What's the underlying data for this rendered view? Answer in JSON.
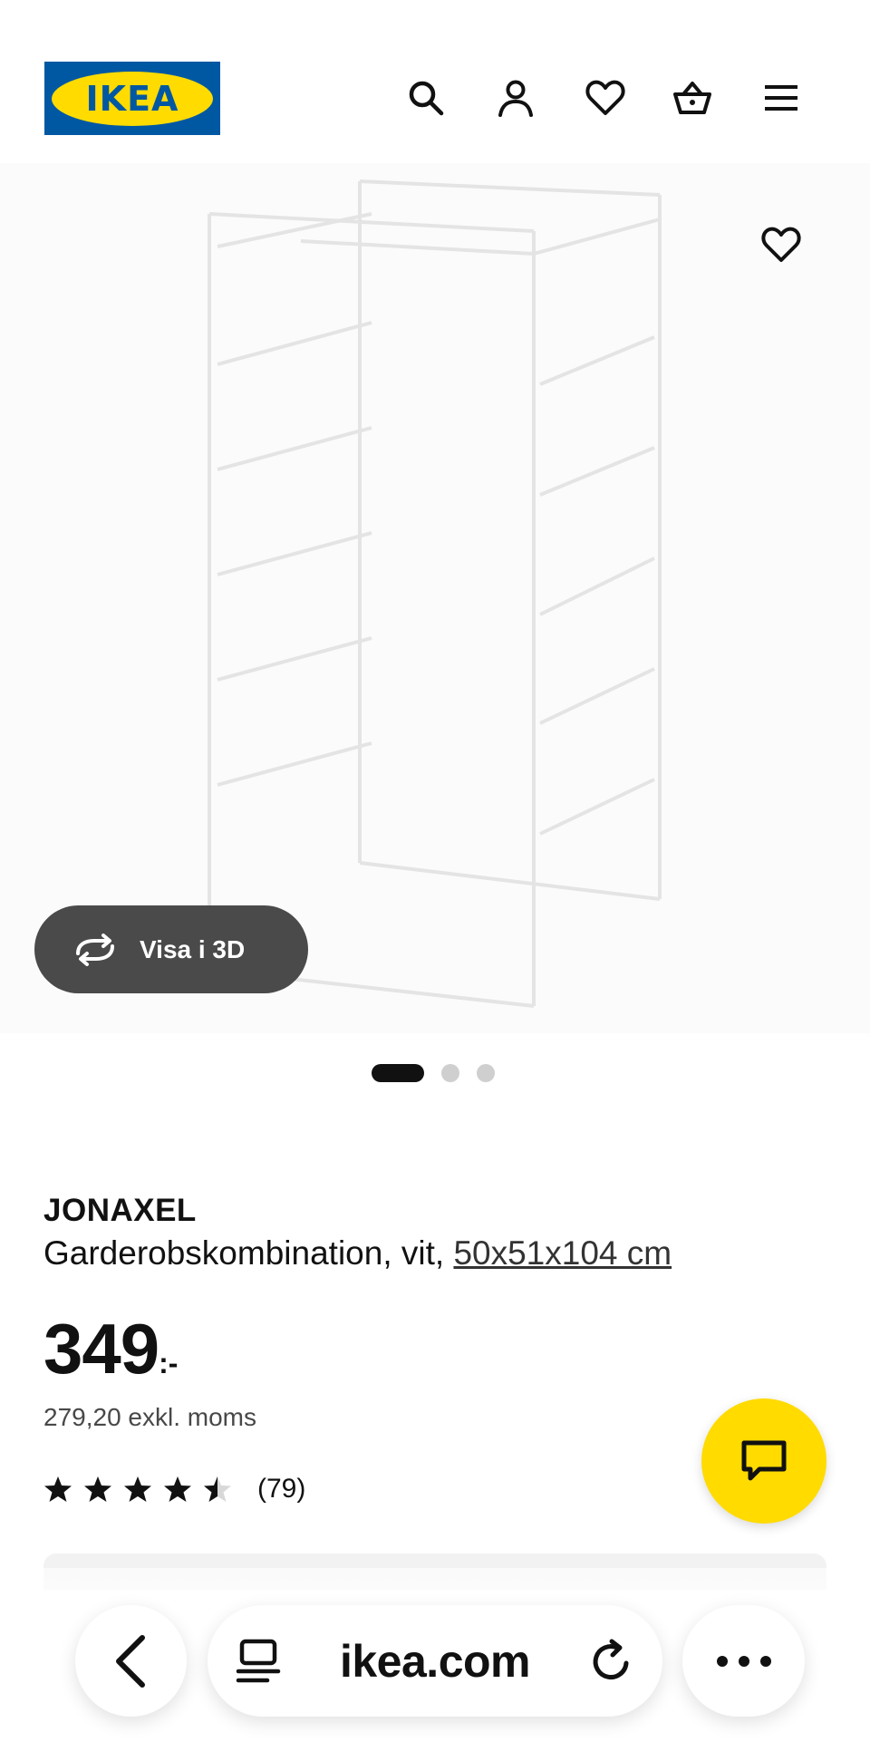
{
  "header": {
    "logo_text": "IKEA",
    "icons": [
      "search-icon",
      "account-icon",
      "favorites-icon",
      "cart-icon",
      "menu-icon"
    ]
  },
  "product_image": {
    "favorite_icon": "heart-icon",
    "view_3d_label": "Visa i 3D",
    "pager": {
      "total": 3,
      "active": 1
    }
  },
  "product": {
    "name": "JONAXEL",
    "description": "Garderobskombination, vit,",
    "size": "50x51x104 cm",
    "price": "349",
    "price_suffix": ":-",
    "price_excl_vat": "279,20 exkl. moms",
    "rating": 4.5,
    "rating_max": 5,
    "review_count": "(79)"
  },
  "chat": {
    "icon": "chat-icon"
  },
  "browser": {
    "url": "ikea.com",
    "back_icon": "chevron-left-icon",
    "tabs_icon": "tabs-icon",
    "reload_icon": "reload-icon",
    "more_icon": "more-icon"
  },
  "colors": {
    "ikea_blue": "#0058a3",
    "ikea_yellow": "#ffdb00",
    "text": "#111111",
    "view3d_bg": "#4a4a4a"
  }
}
